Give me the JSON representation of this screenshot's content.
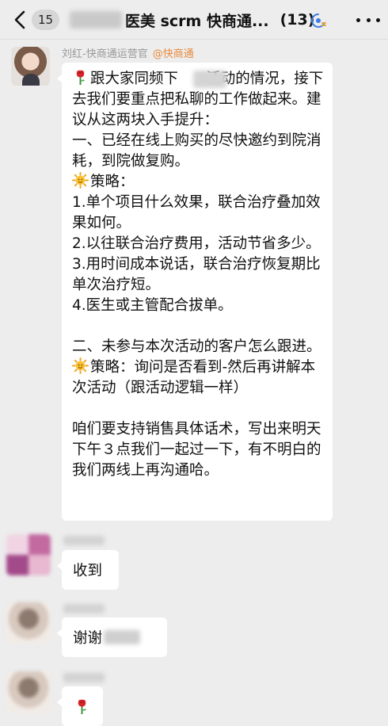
{
  "header": {
    "back_label": "15",
    "title": "医美 scrm 快商通...",
    "member_count": "(13)"
  },
  "main_message": {
    "sender_name": "刘红-快商通运营官",
    "sender_corp": "@快商通",
    "paragraphs": [
      {
        "emoji": "rose-emoji",
        "text": "跟大家同频下      活动的情况，接下去我们要重点把私聊的工作做起来。建议从这两块入手提升："
      },
      {
        "emoji": "",
        "text": "一、已经在线上购买的尽快邀约到院消耗，到院做复购。"
      },
      {
        "emoji": "sun-emoji",
        "text": "策略："
      },
      {
        "emoji": "",
        "text": "1.单个项目什么效果，联合治疗叠加效果如何。"
      },
      {
        "emoji": "",
        "text": "2.以往联合治疗费用，活动节省多少。"
      },
      {
        "emoji": "",
        "text": "3.用时间成本说话，联合治疗恢复期比单次治疗短。"
      },
      {
        "emoji": "",
        "text": "4.医生或主管配合拔单。"
      },
      {
        "emoji": "",
        "text": ""
      },
      {
        "emoji": "",
        "text": "二、未参与本次活动的客户怎么跟进。"
      },
      {
        "emoji": "sun-emoji",
        "text": "策略：询问是否看到-然后再讲解本次活动（跟活动逻辑一样）"
      },
      {
        "emoji": "",
        "text": ""
      },
      {
        "emoji": "",
        "text": "咱们要支持销售具体话术，写出来明天下午３点我们一起过一下，有不明白的我们两线上再沟通哈。"
      }
    ]
  },
  "reply_received": "收到",
  "reply_thanks": "谢谢",
  "reply_rose": "rose-emoji",
  "colors": {
    "background": "#ededed",
    "bubble": "#ffffff",
    "corp_tag": "#e88a3c",
    "sender": "#999999"
  }
}
